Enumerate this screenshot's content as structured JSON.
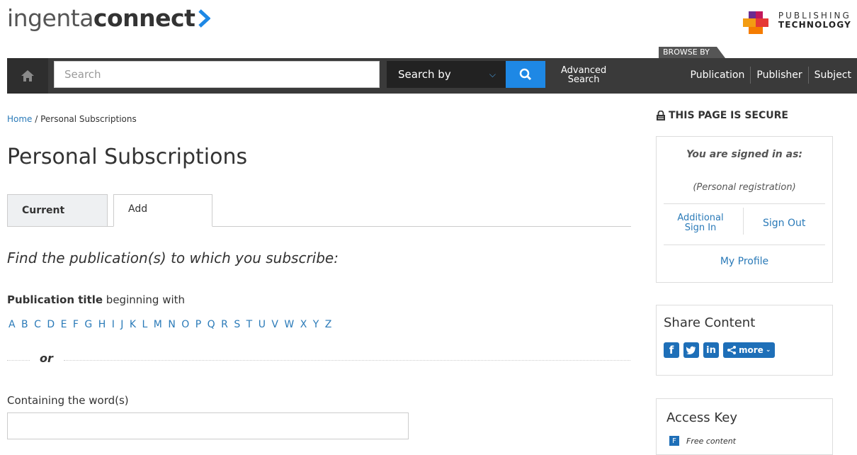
{
  "header": {
    "logo_light": "ingenta",
    "logo_bold": "connect",
    "pt_line1": "PUBLISHING",
    "pt_line2": "TECHNOLOGY",
    "browse_by": "BROWSE BY",
    "search_placeholder": "Search",
    "search_by": "Search by",
    "advanced_line1": "Advanced",
    "advanced_line2": "Search",
    "browse_links": [
      "Publication",
      "Publisher",
      "Subject"
    ]
  },
  "breadcrumb": {
    "home": "Home",
    "separator": " / ",
    "current": "Personal Subscriptions"
  },
  "page_title": "Personal Subscriptions",
  "tabs": [
    {
      "label": "Current"
    },
    {
      "label": "Add"
    }
  ],
  "form": {
    "find_heading": "Find the publication(s) to which you subscribe:",
    "pub_title_bold": "Publication title",
    "pub_title_rest": " beginning with",
    "letters": [
      "A",
      "B",
      "C",
      "D",
      "E",
      "F",
      "G",
      "H",
      "I",
      "J",
      "K",
      "L",
      "M",
      "N",
      "O",
      "P",
      "Q",
      "R",
      "S",
      "T",
      "U",
      "V",
      "W",
      "X",
      "Y",
      "Z"
    ],
    "or": "or",
    "containing_label": "Containing the word(s)"
  },
  "sidebar": {
    "secure": "THIS PAGE IS SECURE",
    "signed_as": "You are signed in as:",
    "personal": "(Personal registration)",
    "additional_line1": "Additional",
    "additional_line2": "Sign In",
    "sign_out": "Sign Out",
    "my_profile": "My Profile",
    "share_title": "Share Content",
    "share_more": "more",
    "access_title": "Access Key",
    "access_free_letter": "F",
    "access_free": "Free content"
  },
  "colors": {
    "accent": "#1e88e5",
    "link": "#2a7ab8",
    "nav": "#3a3a3a"
  }
}
